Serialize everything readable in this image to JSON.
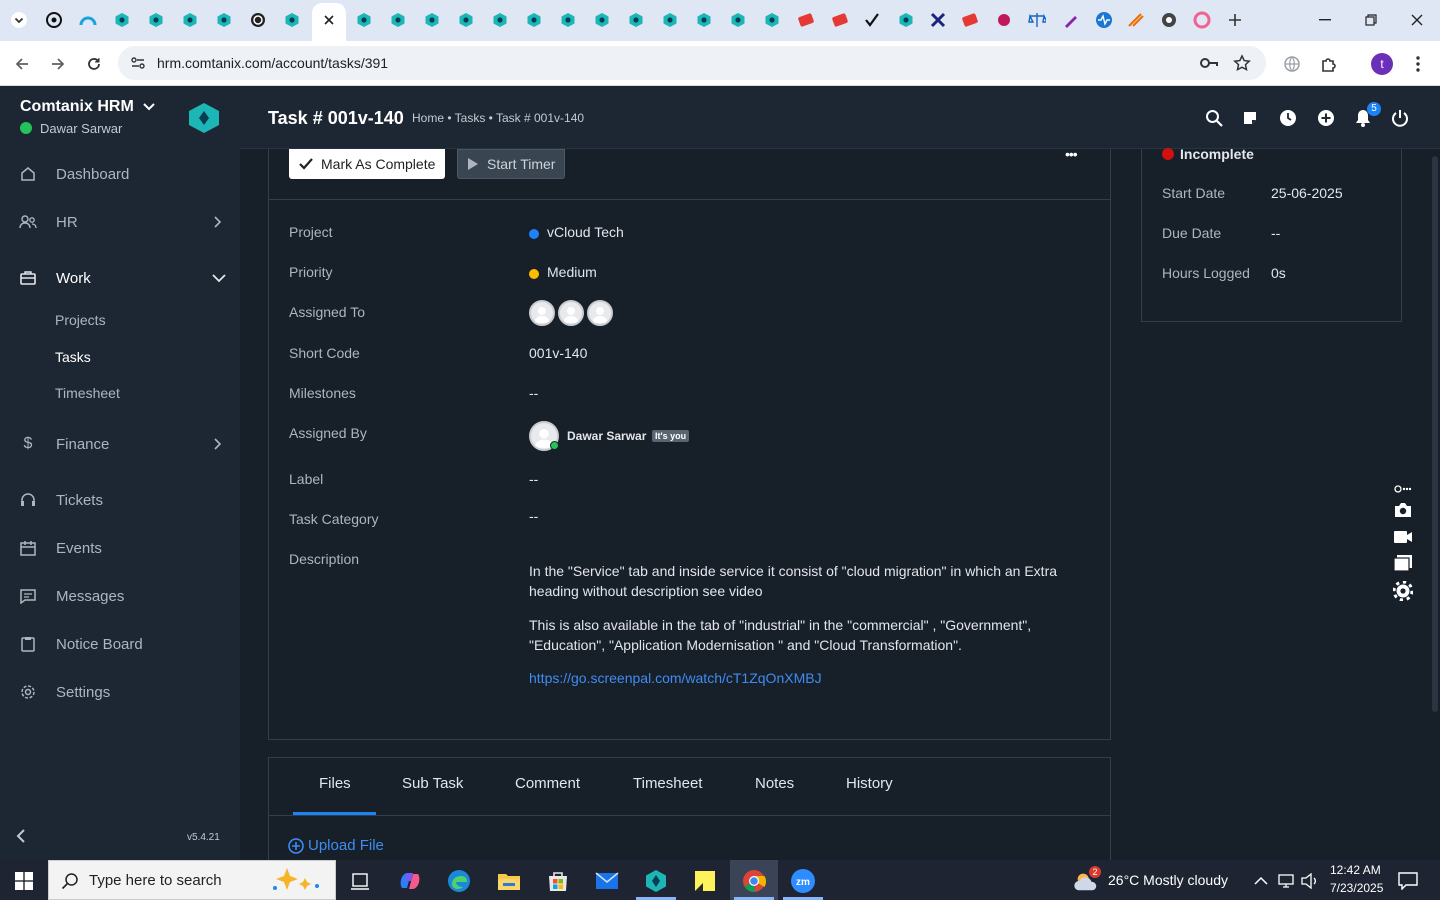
{
  "browser": {
    "url": "hrm.comtanix.com/account/tasks/391",
    "profile_initial": "t",
    "colors": {
      "tabstrip": "#dfe6f4",
      "toolbar": "#ffffff",
      "accent": "#1a73e8"
    }
  },
  "sidebar": {
    "company": "Comtanix HRM",
    "user": "Dawar Sarwar",
    "items": [
      {
        "label": "Dashboard",
        "icon": "home-icon"
      },
      {
        "label": "HR",
        "icon": "users-icon"
      },
      {
        "label": "Work",
        "icon": "briefcase-icon"
      },
      {
        "label": "Finance",
        "icon": "dollar-icon"
      },
      {
        "label": "Tickets",
        "icon": "headset-icon"
      },
      {
        "label": "Events",
        "icon": "calendar-icon"
      },
      {
        "label": "Messages",
        "icon": "message-icon"
      },
      {
        "label": "Notice Board",
        "icon": "clipboard-icon"
      },
      {
        "label": "Settings",
        "icon": "gear-icon"
      }
    ],
    "work_sub": [
      "Projects",
      "Tasks",
      "Timesheet"
    ],
    "version": "v5.4.21"
  },
  "header": {
    "title": "Task # 001v-140",
    "breadcrumb": "Home • Tasks • Task # 001v-140",
    "notification_count": "5"
  },
  "task": {
    "mark_complete": "Mark As Complete",
    "start_timer": "Start Timer",
    "more": "•••",
    "fields": {
      "project_label": "Project",
      "project": "vCloud Tech",
      "priority_label": "Priority",
      "priority": "Medium",
      "assigned_to_label": "Assigned To",
      "short_code_label": "Short Code",
      "short_code": "001v-140",
      "milestones_label": "Milestones",
      "milestones": "--",
      "assigned_by_label": "Assigned By",
      "assigned_by": "Dawar Sarwar",
      "its_you": "It's you",
      "label_label": "Label",
      "label": "--",
      "category_label": "Task Category",
      "category": "--",
      "description_label": "Description"
    },
    "description": {
      "p1": "In the \"Service\" tab and inside service it consist of \"cloud migration\" in which an Extra heading without description see video",
      "p2": "This is also available in the tab of \"industrial\" in the \"commercial\" , \"Government\", \"Education\", \"Application Modernisation \" and \"Cloud Transformation\".",
      "link": "https://go.screenpal.com/watch/cT1ZqOnXMBJ"
    },
    "colors": {
      "project_dot": "#1d82f5",
      "priority_dot": "#fcbd01",
      "status_dot": "#d21010",
      "link": "#3f8cf2"
    }
  },
  "status_card": {
    "status": "Incomplete",
    "start_date_label": "Start Date",
    "start_date": "25-06-2025",
    "due_date_label": "Due Date",
    "due_date": "--",
    "hours_label": "Hours Logged",
    "hours": "0s"
  },
  "tabs": {
    "items": [
      "Files",
      "Sub Task",
      "Comment",
      "Timesheet",
      "Notes",
      "History"
    ],
    "active": "Files",
    "upload": "Upload File"
  },
  "taskbar": {
    "search_placeholder": "Type here to search",
    "weather": "26°C  Mostly cloudy",
    "weather_badge": "2",
    "time": "12:42 AM",
    "date": "7/23/2025"
  }
}
